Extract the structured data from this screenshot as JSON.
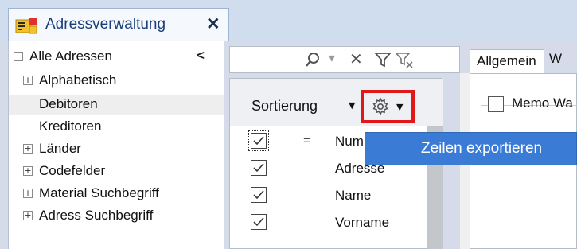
{
  "window_tab": {
    "title": "Adressverwaltung",
    "close_glyph": "✕",
    "icon": "address-book-icon"
  },
  "tree": {
    "collapse_glyph": "<",
    "items": [
      {
        "label": "Alle Adressen",
        "expander": "⊟"
      },
      {
        "label": "Alphabetisch",
        "expander": "⊞"
      },
      {
        "label": "Debitoren",
        "selected": true
      },
      {
        "label": "Kreditoren"
      },
      {
        "label": "Länder",
        "expander": "⊞"
      },
      {
        "label": "Codefelder",
        "expander": "⊞"
      },
      {
        "label": "Material Suchbegriff",
        "expander": "⊞"
      },
      {
        "label": "Adress Suchbegriff",
        "expander": "⊞"
      }
    ]
  },
  "search_toolbar": {
    "icons": [
      "search-icon",
      "dropdown-icon",
      "clear-icon",
      "filter-icon",
      "clear-filter-icon"
    ],
    "search_glyph": "⚲",
    "dropdown_glyph": "▾",
    "clear_glyph": "✕"
  },
  "sort_panel": {
    "header": "Sortierung",
    "caret": "▼",
    "gear_caret": "▼",
    "rows": [
      {
        "checked": true,
        "eq": "=",
        "field": "Num"
      },
      {
        "checked": true,
        "eq": "",
        "field": "Adresse"
      },
      {
        "checked": true,
        "eq": "",
        "field": "Name"
      },
      {
        "checked": true,
        "eq": "",
        "field": "Vorname"
      }
    ]
  },
  "detail": {
    "tabs": [
      "Allgemein",
      "W"
    ],
    "memo_label": "Memo Wa"
  },
  "popup": {
    "item": "Zeilen exportieren"
  },
  "colors": {
    "accent": "#3a7bd5",
    "highlight_border": "#e01818",
    "tab_text": "#1b3f7a",
    "panel_bg": "#d6dbe9"
  }
}
